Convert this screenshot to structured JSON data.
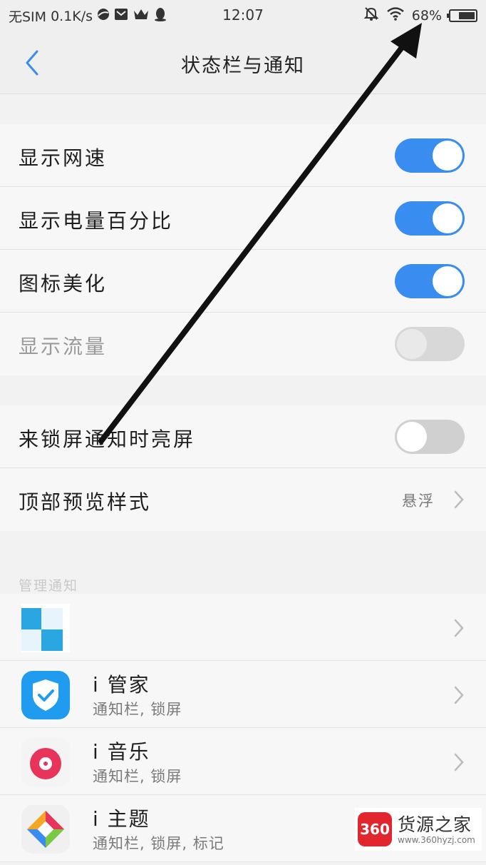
{
  "status_bar": {
    "carrier": "无SIM",
    "speed": "0.1K/s",
    "time": "12:07",
    "battery_percent": "68%",
    "battery_level": 0.68
  },
  "title_bar": {
    "title": "状态栏与通知"
  },
  "group1": {
    "items": [
      {
        "label": "显示网速",
        "state": "on"
      },
      {
        "label": "显示电量百分比",
        "state": "on"
      },
      {
        "label": "图标美化",
        "state": "on"
      },
      {
        "label": "显示流量",
        "state": "disabled-off"
      }
    ]
  },
  "group2": {
    "lock_screen": {
      "label": "来锁屏通知时亮屏",
      "state": "off"
    },
    "preview_style": {
      "label": "顶部预览样式",
      "value": "悬浮"
    }
  },
  "manage": {
    "header": "管理通知",
    "apps": [
      {
        "name": "",
        "sub": ""
      },
      {
        "name": "i 管家",
        "sub": "通知栏, 锁屏"
      },
      {
        "name": "i 音乐",
        "sub": "通知栏, 锁屏"
      },
      {
        "name": "i 主题",
        "sub": "通知栏, 锁屏, 标记"
      }
    ]
  },
  "watermark": {
    "badge": "360",
    "name": "货源之家",
    "url": "www.360hyzj.com"
  },
  "colors": {
    "accent": "#3a8df0",
    "toggle_off": "#d0d0d0",
    "annotation_arrow": "#111111"
  }
}
